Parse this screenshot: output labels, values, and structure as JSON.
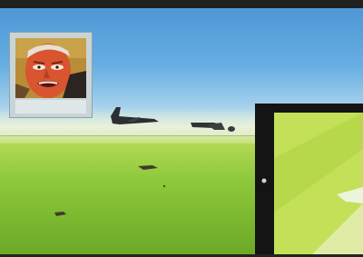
{
  "hud": {
    "items": [
      "",
      "",
      ""
    ]
  },
  "colors": {
    "sky": "#5ea8df",
    "ground": "#8fc93b",
    "pilot_skin": "#d8552f",
    "pilot_background": "#b98c38",
    "cockpit_frame": "#111111"
  },
  "icons": {
    "bomber": "bomber-aircraft-icon",
    "fighter": "fighter-aircraft-icon",
    "pilot": "pilot-portrait-icon"
  }
}
